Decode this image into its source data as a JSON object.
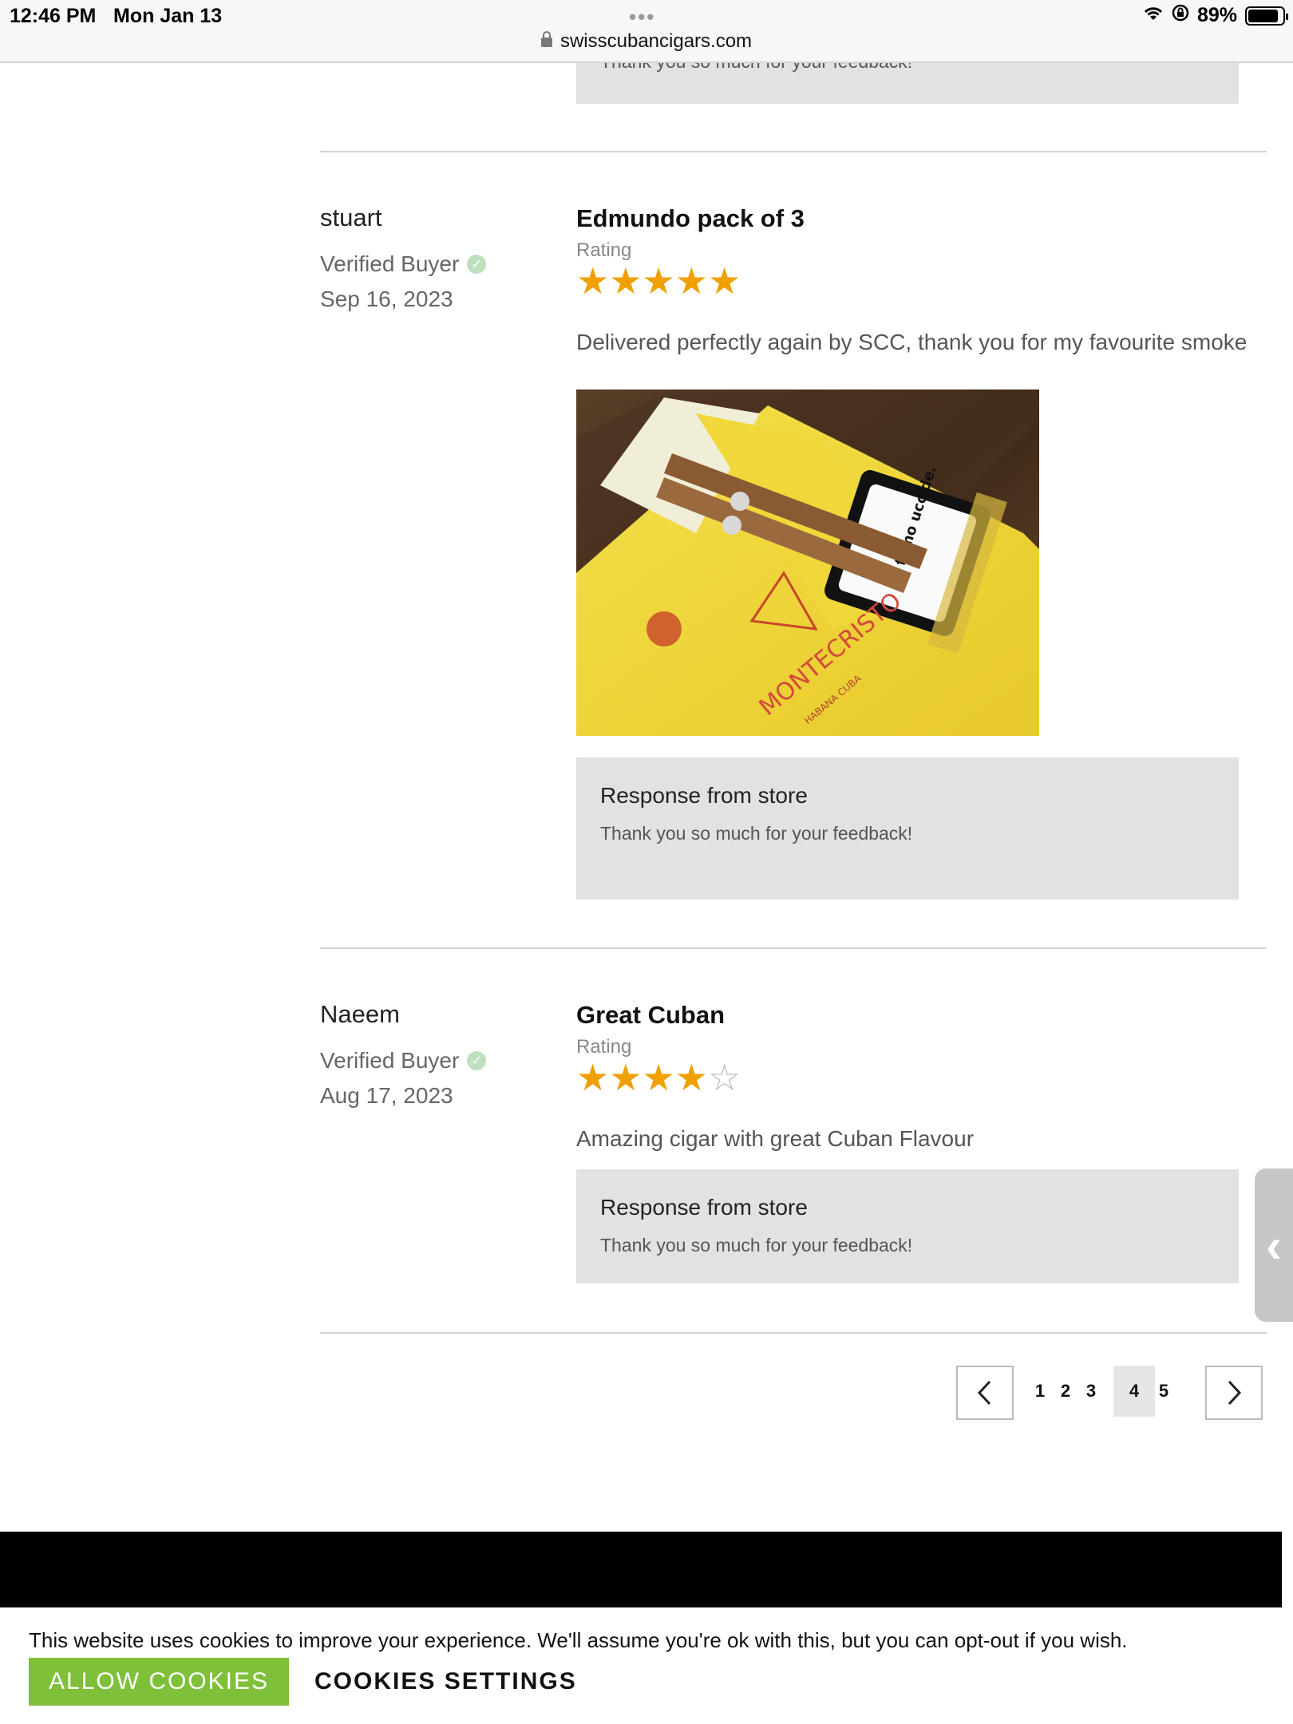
{
  "status_bar": {
    "time": "12:46 PM",
    "date": "Mon Jan 13",
    "battery": "89%",
    "battery_level": 0.89
  },
  "browser": {
    "url": "swisscubancigars.com"
  },
  "top_response": {
    "text": "Thank you so much for your feedback!"
  },
  "reviews": [
    {
      "name": "stuart",
      "verified": "Verified Buyer",
      "date": "Sep 16, 2023",
      "title": "Edmundo pack of 3",
      "rating_label": "Rating",
      "rating": 5,
      "body": "Delivered perfectly again by SCC, thank you for my favourite smoke",
      "photo": {
        "brand": "MONTECRISTO",
        "origin": "HABANA CUBA",
        "warning": "Il fumo uccide."
      },
      "response_title": "Response from store",
      "response_text": "Thank you so much for your feedback!"
    },
    {
      "name": "Naeem",
      "verified": "Verified Buyer",
      "date": "Aug 17, 2023",
      "title": "Great Cuban",
      "rating_label": "Rating",
      "rating": 4,
      "body": "Amazing cigar with great Cuban Flavour",
      "response_title": "Response from store",
      "response_text": "Thank you so much for your feedback!"
    }
  ],
  "pagination": {
    "pages": [
      "1",
      "2",
      "3",
      "4",
      "5"
    ],
    "current": "4"
  },
  "cookie_banner": {
    "message": "This website uses cookies to improve your experience. We'll assume you're ok with this, but you can opt-out if you wish.",
    "allow_label": "ALLOW COOKIES",
    "settings_label": "COOKIES SETTINGS",
    "allow_color": "#7ec03a"
  },
  "colors": {
    "star": "#f0a000",
    "response_bg": "#e2e2e2"
  }
}
